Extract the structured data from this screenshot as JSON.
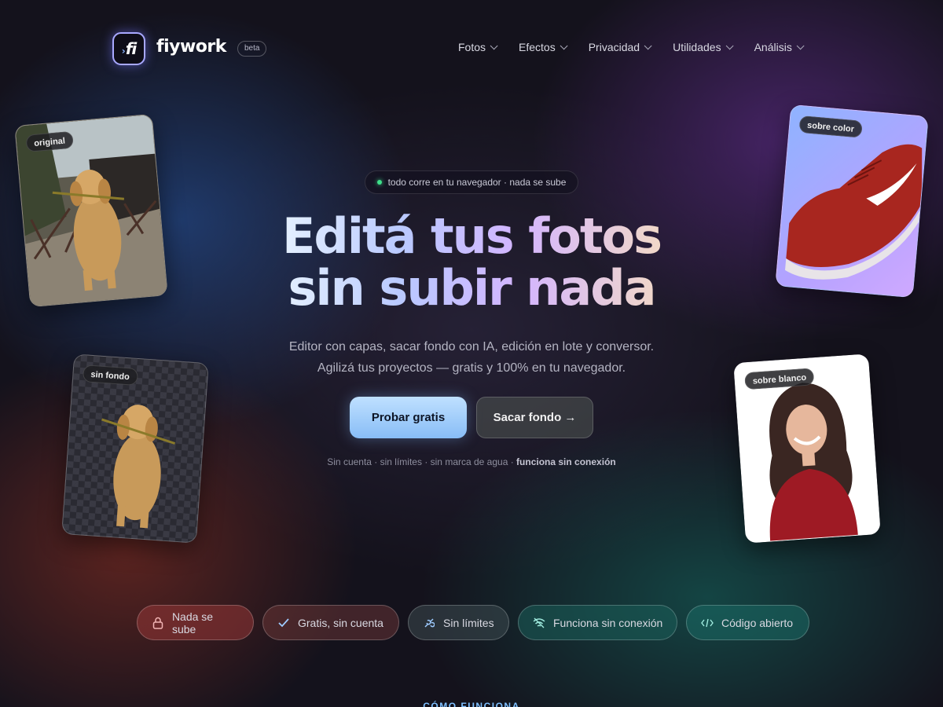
{
  "header": {
    "brand": "fiywork",
    "logo_text": "fi",
    "badge": "beta",
    "nav": [
      {
        "label": "Fotos"
      },
      {
        "label": "Efectos"
      },
      {
        "label": "Privacidad"
      },
      {
        "label": "Utilidades"
      },
      {
        "label": "Análisis"
      }
    ]
  },
  "hero": {
    "pill": "todo corre en tu navegador · nada se sube",
    "title_line1": "Editá tus fotos",
    "title_line2": "sin subir nada",
    "subtitle_line1": "Editor con capas, sacar fondo con IA, edición en lote y conversor.",
    "subtitle_line2": "Agilizá tus proyectos — gratis y 100% en tu navegador.",
    "primary_cta": "Probar gratis",
    "secondary_cta": "Sacar fondo →",
    "footnote": "Sin cuenta · sin límites · sin marca de agua ·",
    "footnote_bold": "funciona sin conexión"
  },
  "cards": {
    "original": "original",
    "no_background": "sin fondo",
    "on_color": "sobre color",
    "on_white": "sobre blanco"
  },
  "features": [
    {
      "label": "Nada se sube",
      "icon": "lock-icon"
    },
    {
      "label": "Gratis, sin cuenta",
      "icon": "check-icon"
    },
    {
      "label": "Sin límites",
      "icon": "infinity-icon"
    },
    {
      "label": "Funciona sin conexión",
      "icon": "wifi-off-icon"
    },
    {
      "label": "Código abierto",
      "icon": "code-icon"
    }
  ],
  "section": {
    "label": "CÓMO FUNCIONA"
  },
  "colors": {
    "accent_blue": "#88bdf6",
    "status_green": "#3ee08a",
    "background": "#14121c"
  }
}
